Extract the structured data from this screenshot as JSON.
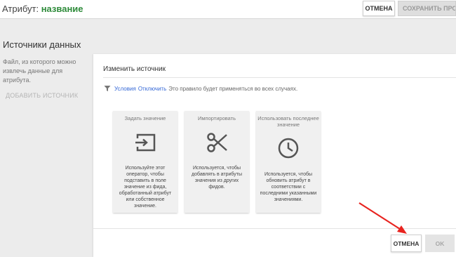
{
  "header": {
    "title_prefix": "Атрибут:",
    "title_name": "название",
    "cancel_label": "ОТМЕНА",
    "save_label": "СОХРАНИТЬ ПРОЕК"
  },
  "sidebar": {
    "title": "Источники данных",
    "description": "Файл, из которого можно извлечь данные для атрибута.",
    "add_source_label": "ДОБАВИТЬ ИСТОЧНИК"
  },
  "dialog": {
    "title": "Изменить источник",
    "condition": {
      "icon": "filter-icon",
      "conditions_link": "Условия",
      "disable_link": "Отключить",
      "text": "Это правило будет применяться во всех случаях."
    },
    "options": [
      {
        "label": "Задать значение",
        "icon": "input-icon",
        "description": "Используйте этот оператор, чтобы подставить в поле значение из фида, обработанный атрибут или собственное значение."
      },
      {
        "label": "Импортировать",
        "icon": "scissors-icon",
        "description": "Используется, чтобы добавлять в атрибуты значения из других фидов."
      },
      {
        "label": "Использовать последнее значение",
        "icon": "clock-icon",
        "description": "Используется, чтобы обновить атрибут в соответствии с последними указанными значениями."
      }
    ],
    "cancel_label": "ОТМЕНА",
    "ok_label": "OK"
  },
  "colors": {
    "attribute_name": "#2e8b3a",
    "link": "#3367d6",
    "annotation_arrow": "#e8231f"
  }
}
